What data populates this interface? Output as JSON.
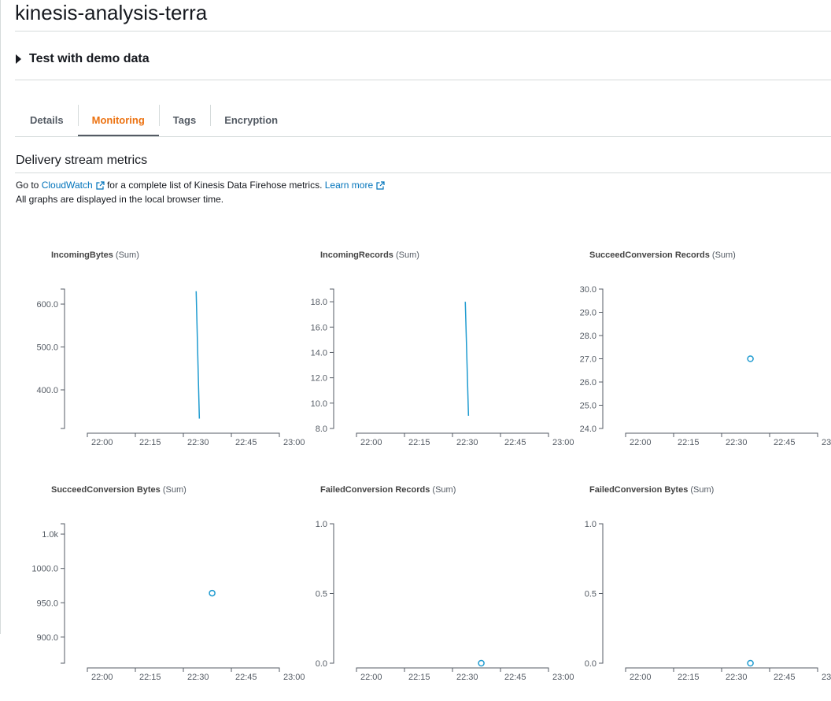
{
  "page": {
    "title": "kinesis-analysis-terra"
  },
  "expander": {
    "label": "Test with demo data"
  },
  "tabs": [
    {
      "label": "Details",
      "active": false
    },
    {
      "label": "Monitoring",
      "active": true
    },
    {
      "label": "Tags",
      "active": false
    },
    {
      "label": "Encryption",
      "active": false
    }
  ],
  "section": {
    "title": "Delivery stream metrics",
    "line1_prefix": "Go to",
    "cloudwatch_link": "CloudWatch",
    "line1_middle": "for a complete list of Kinesis Data Firehose metrics.",
    "learn_more_link": "Learn more",
    "line2": "All graphs are displayed in the local browser time."
  },
  "colors": {
    "accent": "#ec7211",
    "link": "#0073bb",
    "series": "#1f9bd0",
    "axis": "#545b64"
  },
  "icons": {
    "expander": "caret-right-icon",
    "external": "external-link-icon"
  },
  "chart_data": [
    {
      "type": "line",
      "metric": "IncomingBytes",
      "stat": "(Sum)",
      "xticks": [
        "22:00",
        "22:15",
        "22:30",
        "22:45",
        "23:00"
      ],
      "ylim": [
        310,
        635
      ],
      "yticks": [
        "400.0",
        "500.0",
        "600.0"
      ],
      "ytick_values": [
        400,
        500,
        600
      ],
      "series": [
        {
          "points": [
            [
              "22:34",
              630
            ],
            [
              "22:35",
              333
            ]
          ]
        }
      ]
    },
    {
      "type": "line",
      "metric": "IncomingRecords",
      "stat": "(Sum)",
      "xticks": [
        "22:00",
        "22:15",
        "22:30",
        "22:45",
        "23:00"
      ],
      "ylim": [
        8,
        19
      ],
      "yticks": [
        "8.0",
        "10.0",
        "12.0",
        "14.0",
        "16.0",
        "18.0"
      ],
      "ytick_values": [
        8,
        10,
        12,
        14,
        16,
        18
      ],
      "series": [
        {
          "points": [
            [
              "22:34",
              18
            ],
            [
              "22:35",
              9
            ]
          ]
        }
      ]
    },
    {
      "type": "scatter",
      "metric": "SucceedConversion Records",
      "stat": "(Sum)",
      "xticks": [
        "22:00",
        "22:15",
        "22:30",
        "22:45",
        "23:00"
      ],
      "ylim": [
        24,
        30
      ],
      "yticks": [
        "24.0",
        "25.0",
        "26.0",
        "27.0",
        "28.0",
        "29.0",
        "30.0"
      ],
      "ytick_values": [
        24,
        25,
        26,
        27,
        28,
        29,
        30
      ],
      "series": [
        {
          "points": [
            [
              "22:39",
              27
            ]
          ]
        }
      ]
    },
    {
      "type": "scatter",
      "metric": "SucceedConversion Bytes",
      "stat": "(Sum)",
      "xticks": [
        "22:00",
        "22:15",
        "22:30",
        "22:45",
        "23:00"
      ],
      "ylim": [
        862,
        1065
      ],
      "yticks": [
        "900.0",
        "950.0",
        "1000.0",
        "1.0k"
      ],
      "ytick_values": [
        900,
        950,
        1000,
        1050
      ],
      "series": [
        {
          "points": [
            [
              "22:39",
              964
            ]
          ]
        }
      ]
    },
    {
      "type": "scatter",
      "metric": "FailedConversion Records",
      "stat": "(Sum)",
      "xticks": [
        "22:00",
        "22:15",
        "22:30",
        "22:45",
        "23:00"
      ],
      "ylim": [
        0,
        1
      ],
      "yticks": [
        "0.0",
        "0.5",
        "1.0"
      ],
      "ytick_values": [
        0,
        0.5,
        1
      ],
      "series": [
        {
          "points": [
            [
              "22:39",
              0
            ]
          ]
        }
      ]
    },
    {
      "type": "scatter",
      "metric": "FailedConversion Bytes",
      "stat": "(Sum)",
      "xticks": [
        "22:00",
        "22:15",
        "22:30",
        "22:45",
        "23:00"
      ],
      "ylim": [
        0,
        1
      ],
      "yticks": [
        "0.0",
        "0.5",
        "1.0"
      ],
      "ytick_values": [
        0,
        0.5,
        1
      ],
      "series": [
        {
          "points": [
            [
              "22:39",
              0
            ]
          ]
        }
      ]
    }
  ]
}
